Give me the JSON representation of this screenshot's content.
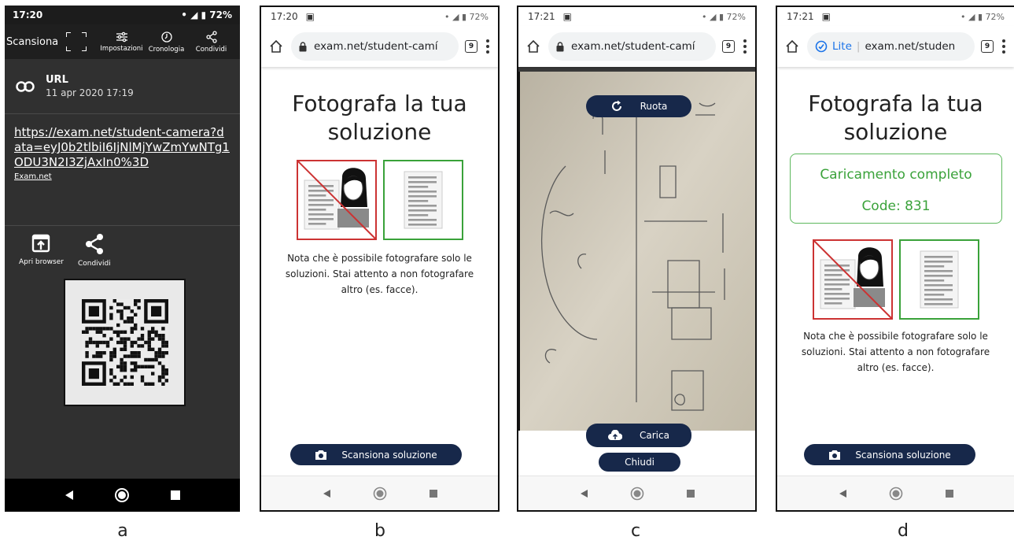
{
  "panel_a": {
    "status_time": "17:20",
    "status_battery": "72%",
    "toolbar": {
      "title": "Scansiona",
      "settings": "Impostazioni",
      "history": "Cronologia",
      "share": "Condividi"
    },
    "result": {
      "type": "URL",
      "date": "11 apr 2020 17:19",
      "url": "https://exam.net/student-camera?data=eyJ0b2tlbiI6IjNlMjYwZmYwNTg1ODU3N2I3ZjAxIn0%3D",
      "source": "Exam.net"
    },
    "actions": {
      "open_browser": "Apri browser",
      "share": "Condividi"
    }
  },
  "panel_b": {
    "status_time": "17:20",
    "status_battery": "72%",
    "url": "exam.net/student-camí",
    "tabs": "9",
    "heading": "Fotografa la tua soluzione",
    "note": "Nota che è possibile fotografare solo le soluzioni. Stai attento a non fotografare altro (es. facce).",
    "scan_button": "Scansiona soluzione"
  },
  "panel_c": {
    "status_time": "17:21",
    "status_battery": "72%",
    "url": "exam.net/student-camí",
    "tabs": "9",
    "rotate_button": "Ruota",
    "upload_button": "Carica",
    "close_button": "Chiudi"
  },
  "panel_d": {
    "status_time": "17:21",
    "status_battery": "72%",
    "lite_label": "Lite",
    "url": "exam.net/studen",
    "tabs": "9",
    "heading": "Fotografa la tua soluzione",
    "upload_complete": "Caricamento completo",
    "code": "Code: 831",
    "note": "Nota che è possibile fotografare solo le soluzioni. Stai attento a non fotografare altro (es. facce).",
    "scan_button": "Scansiona soluzione"
  },
  "labels": {
    "a": "a",
    "b": "b",
    "c": "c",
    "d": "d"
  },
  "colors": {
    "navy": "#17284a",
    "red": "#cc3333",
    "green": "#3aa23a"
  }
}
